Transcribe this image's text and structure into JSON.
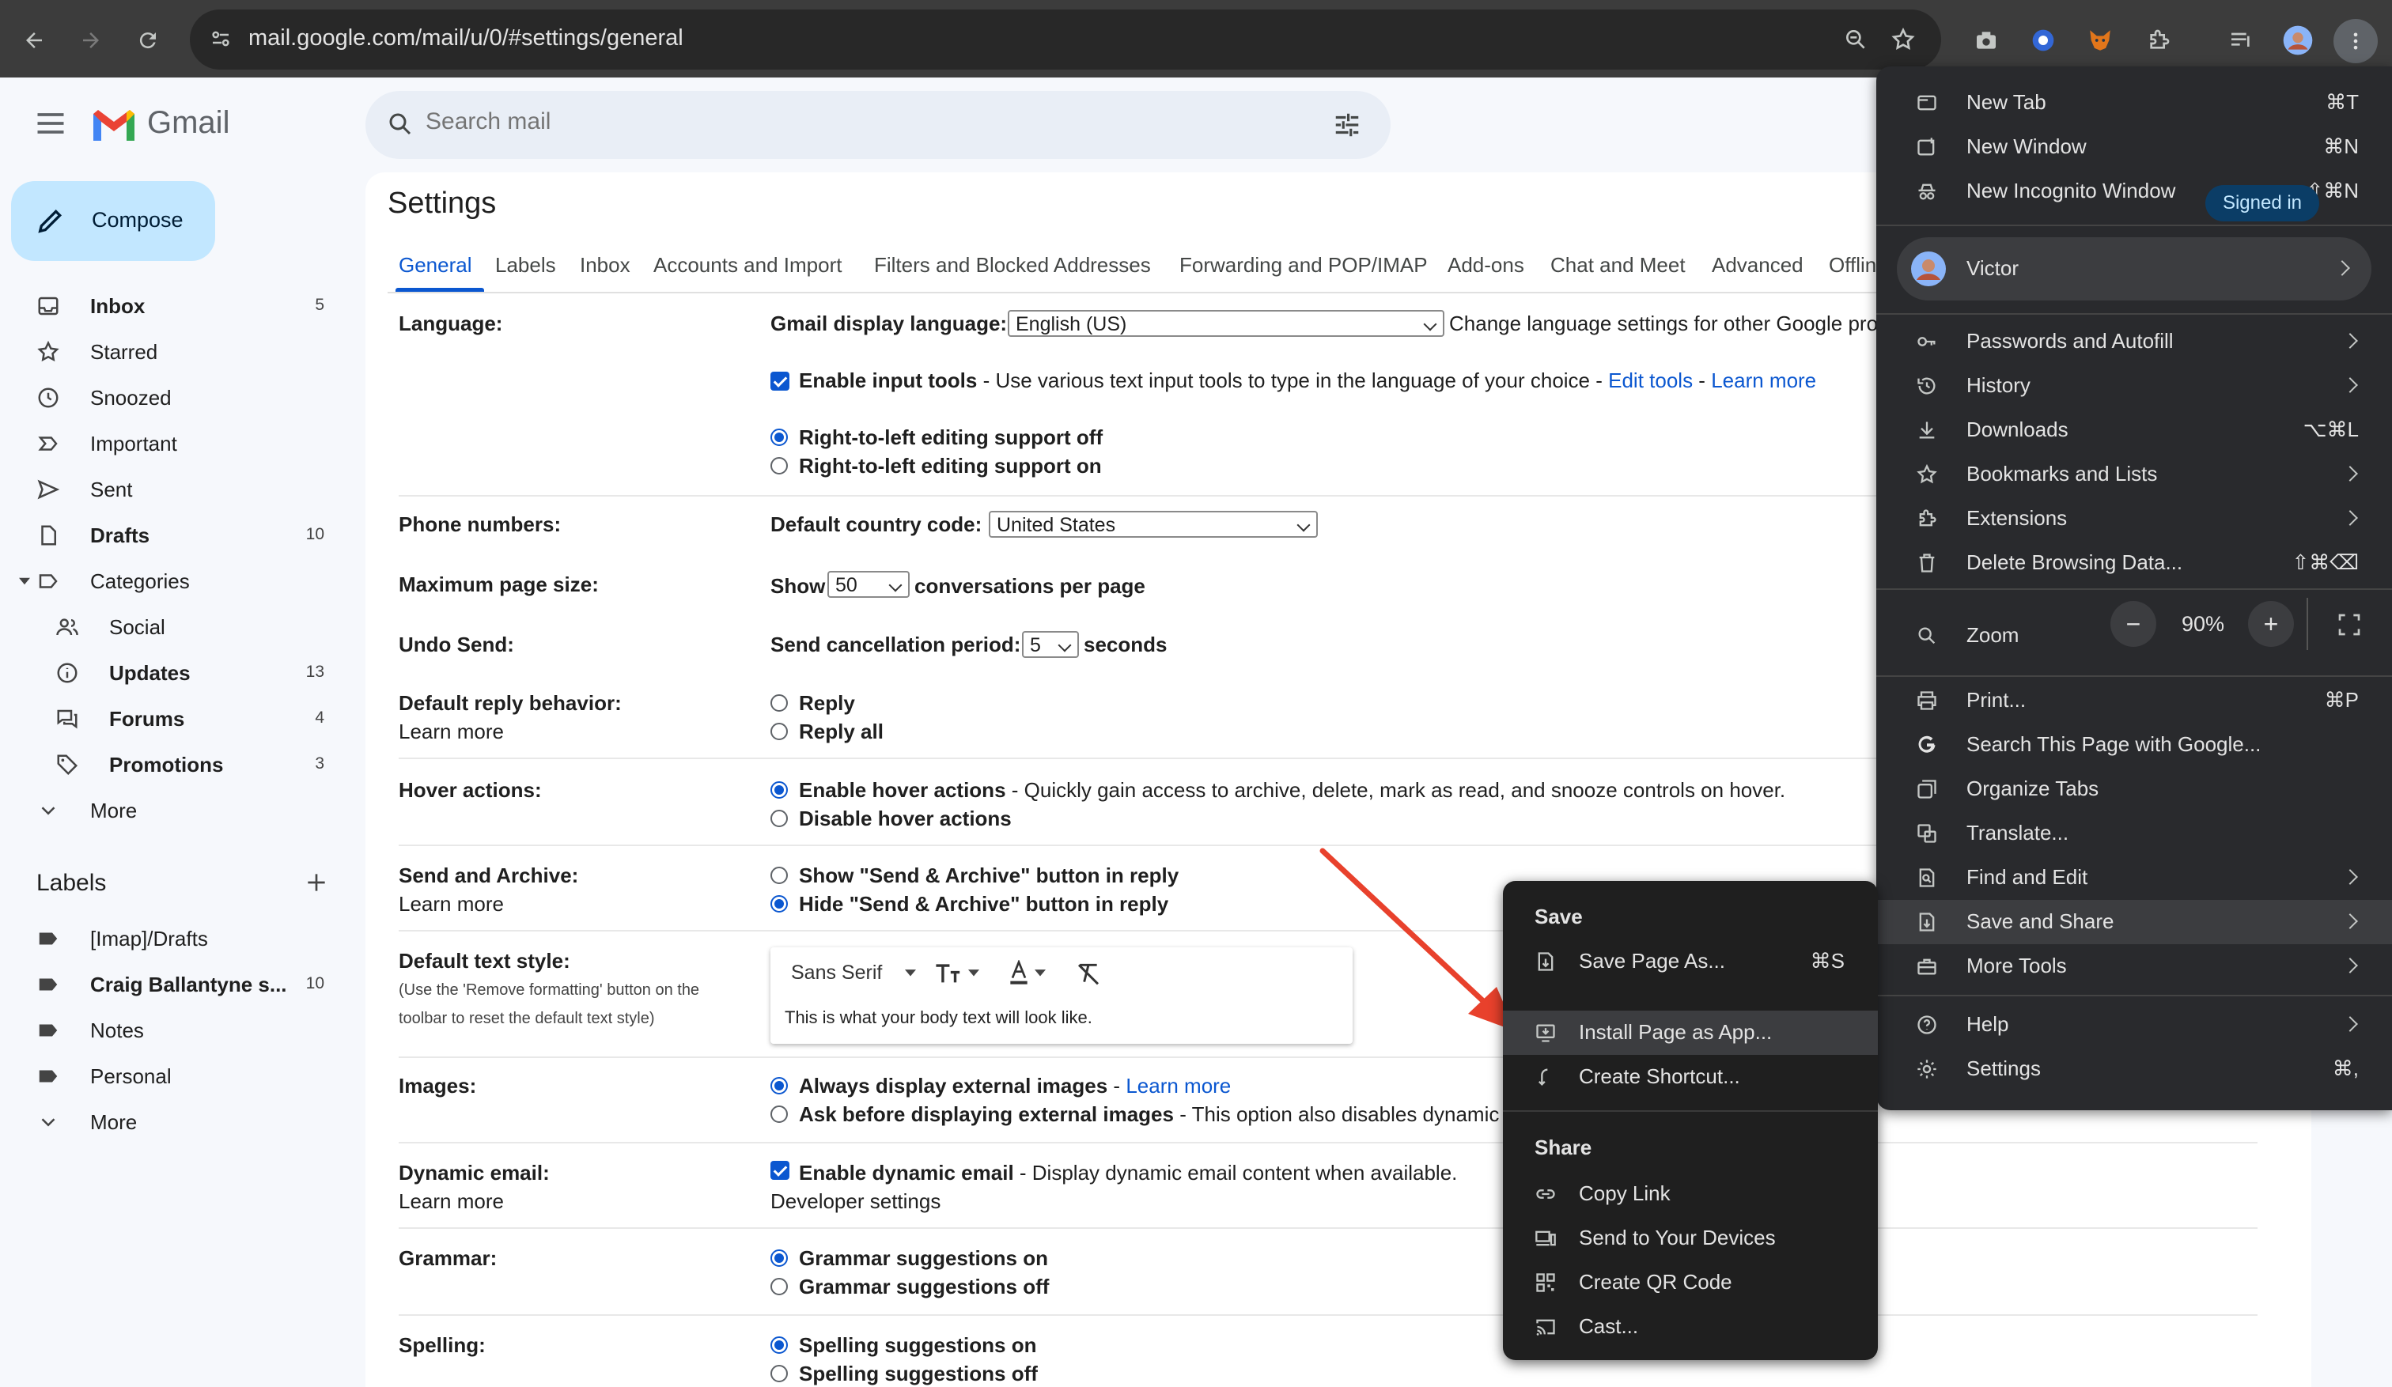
{
  "browser": {
    "url": "mail.google.com/mail/u/0/#settings/general",
    "menu": {
      "items_top": [
        {
          "label": "New Tab",
          "shortcut": "⌘T"
        },
        {
          "label": "New Window",
          "shortcut": "⌘N"
        },
        {
          "label": "New Incognito Window",
          "shortcut": "⇧⌘N"
        }
      ],
      "profile": {
        "name": "Victor",
        "status": "Signed in"
      },
      "items_mid": [
        {
          "label": "Passwords and Autofill"
        },
        {
          "label": "History"
        },
        {
          "label": "Downloads",
          "shortcut": "⌥⌘L"
        },
        {
          "label": "Bookmarks and Lists"
        },
        {
          "label": "Extensions"
        },
        {
          "label": "Delete Browsing Data...",
          "shortcut": "⇧⌘⌫"
        }
      ],
      "zoom": {
        "label": "Zoom",
        "value": "90%",
        "minus": "−",
        "plus": "+"
      },
      "items_bottom": [
        {
          "label": "Print...",
          "shortcut": "⌘P"
        },
        {
          "label": "Search This Page with Google..."
        },
        {
          "label": "Organize Tabs"
        },
        {
          "label": "Translate..."
        },
        {
          "label": "Find and Edit"
        },
        {
          "label": "Save and Share"
        },
        {
          "label": "More Tools"
        }
      ],
      "items_end": [
        {
          "label": "Help"
        },
        {
          "label": "Settings",
          "shortcut": "⌘,"
        }
      ]
    },
    "submenu": {
      "save_heading": "Save",
      "save_items": [
        {
          "label": "Save Page As...",
          "shortcut": "⌘S"
        },
        {
          "label": "Install Page as App..."
        },
        {
          "label": "Create Shortcut..."
        }
      ],
      "share_heading": "Share",
      "share_items": [
        {
          "label": "Copy Link"
        },
        {
          "label": "Send to Your Devices"
        },
        {
          "label": "Create QR Code"
        },
        {
          "label": "Cast..."
        }
      ]
    }
  },
  "gmail": {
    "logo": "Gmail",
    "search_placeholder": "Search mail",
    "compose": "Compose",
    "nav": [
      {
        "label": "Inbox",
        "count": "5"
      },
      {
        "label": "Starred",
        "count": ""
      },
      {
        "label": "Snoozed",
        "count": ""
      },
      {
        "label": "Important",
        "count": ""
      },
      {
        "label": "Sent",
        "count": ""
      },
      {
        "label": "Drafts",
        "count": "10"
      },
      {
        "label": "Categories",
        "count": ""
      },
      {
        "label": "Social",
        "count": ""
      },
      {
        "label": "Updates",
        "count": "13"
      },
      {
        "label": "Forums",
        "count": "4"
      },
      {
        "label": "Promotions",
        "count": "3"
      },
      {
        "label": "More",
        "count": ""
      }
    ],
    "labels_title": "Labels",
    "labels": [
      {
        "label": "[Imap]/Drafts",
        "count": ""
      },
      {
        "label": "Craig Ballantyne s...",
        "count": "10"
      },
      {
        "label": "Notes",
        "count": ""
      },
      {
        "label": "Personal",
        "count": ""
      },
      {
        "label": "More",
        "count": ""
      }
    ]
  },
  "settings": {
    "title": "Settings",
    "tabs": [
      "General",
      "Labels",
      "Inbox",
      "Accounts and Import",
      "Filters and Blocked Addresses",
      "Forwarding and POP/IMAP",
      "Add-ons",
      "Chat and Meet",
      "Advanced",
      "Offlin"
    ],
    "language": {
      "label": "Language:",
      "display_label": "Gmail display language:",
      "display_value": "English (US)",
      "change_link": "Change language settings for other Google pro",
      "input_tools_bold": "Enable input tools",
      "input_tools_text": " - Use various text input tools to type in the language of your choice - ",
      "edit_tools": "Edit tools",
      "sep": " - ",
      "learn_more": "Learn more",
      "rtl_off": "Right-to-left editing support off",
      "rtl_on": "Right-to-left editing support on"
    },
    "phone": {
      "label": "Phone numbers:",
      "country_label": "Default country code:",
      "country_value": "United States"
    },
    "page_size": {
      "label": "Maximum page size:",
      "show": "Show",
      "value": "50",
      "suffix": "conversations per page"
    },
    "undo": {
      "label": "Undo Send:",
      "period_label": "Send cancellation period:",
      "value": "5",
      "suffix": "seconds"
    },
    "reply": {
      "label": "Default reply behavior:",
      "learn_more": "Learn more",
      "opt1": "Reply",
      "opt2": "Reply all"
    },
    "hover": {
      "label": "Hover actions:",
      "opt1_bold": "Enable hover actions",
      "opt1_text": " - Quickly gain access to archive, delete, mark as read, and snooze controls on hover.",
      "opt2": "Disable hover actions"
    },
    "send_archive": {
      "label": "Send and Archive:",
      "learn_more": "Learn more",
      "opt1": "Show \"Send & Archive\" button in reply",
      "opt2": "Hide \"Send & Archive\" button in reply"
    },
    "text_style": {
      "label": "Default text style:",
      "note1": "(Use the 'Remove formatting' button on the",
      "note2": "toolbar to reset the default text style)",
      "font": "Sans Serif",
      "preview": "This is what your body text will look like."
    },
    "images": {
      "label": "Images:",
      "opt1_bold": "Always display external images",
      "opt1_sep": " - ",
      "learn_more": "Learn more",
      "opt2_bold": "Ask before displaying external images",
      "opt2_text": " - This option also disables dynamic e"
    },
    "dynamic": {
      "label": "Dynamic email:",
      "learn_more": "Learn more",
      "opt_bold": "Enable dynamic email",
      "opt_text": " - Display dynamic email content when available.",
      "dev_link": "Developer settings"
    },
    "grammar": {
      "label": "Grammar:",
      "opt1": "Grammar suggestions on",
      "opt2": "Grammar suggestions off"
    },
    "spelling": {
      "label": "Spelling:",
      "opt1": "Spelling suggestions on",
      "opt2": "Spelling suggestions off"
    }
  },
  "colors": {
    "accent": "#0b57d0",
    "compose_bg": "#c2e7ff",
    "annotation_arrow": "#e8412c"
  }
}
